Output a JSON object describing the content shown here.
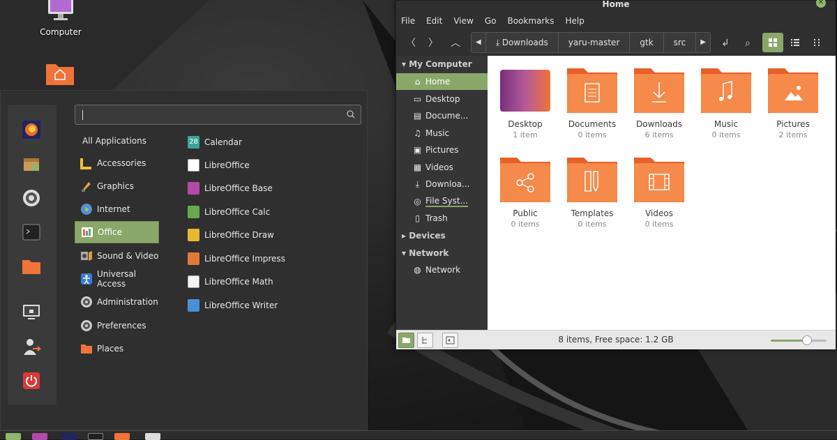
{
  "desktop": {
    "icons": [
      {
        "label": "Computer",
        "icon": "monitor-icon"
      },
      {
        "label": "",
        "icon": "home-folder-icon"
      }
    ]
  },
  "menu": {
    "search": {
      "value": "",
      "placeholder": ""
    },
    "favorites": [
      "firefox-icon",
      "package-icon",
      "settings-icon",
      "terminal-icon",
      "folder-icon",
      "lock-screen-icon",
      "logout-icon",
      "power-icon"
    ],
    "categories": [
      {
        "label": "All Applications"
      },
      {
        "label": "Accessories"
      },
      {
        "label": "Graphics"
      },
      {
        "label": "Internet"
      },
      {
        "label": "Office"
      },
      {
        "label": "Sound & Video"
      },
      {
        "label": "Universal Access"
      },
      {
        "label": "Administration"
      },
      {
        "label": "Preferences"
      },
      {
        "label": "Places"
      }
    ],
    "selected_category": "Office",
    "apps": [
      {
        "label": "Calendar",
        "badge": "28"
      },
      {
        "label": "LibreOffice"
      },
      {
        "label": "LibreOffice Base"
      },
      {
        "label": "LibreOffice Calc"
      },
      {
        "label": "LibreOffice Draw"
      },
      {
        "label": "LibreOffice Impress"
      },
      {
        "label": "LibreOffice Math"
      },
      {
        "label": "LibreOffice Writer"
      }
    ]
  },
  "filemanager": {
    "title": "Home",
    "menubar": [
      "File",
      "Edit",
      "View",
      "Go",
      "Bookmarks",
      "Help"
    ],
    "breadcrumbs": [
      "Downloads",
      "yaru-master",
      "gtk",
      "src"
    ],
    "sidebar": {
      "my_computer": "My Computer",
      "items": [
        "Home",
        "Desktop",
        "Docume...",
        "Music",
        "Pictures",
        "Videos",
        "Downloa...",
        "File Syst...",
        "Trash"
      ],
      "devices": "Devices",
      "network": "Network",
      "network_items": [
        "Network"
      ]
    },
    "files": [
      {
        "name": "Desktop",
        "count": "1 item"
      },
      {
        "name": "Documents",
        "count": "0 items"
      },
      {
        "name": "Downloads",
        "count": "6 items"
      },
      {
        "name": "Music",
        "count": "0 items"
      },
      {
        "name": "Pictures",
        "count": "2 items"
      },
      {
        "name": "Public",
        "count": "0 items"
      },
      {
        "name": "Templates",
        "count": "0 items"
      },
      {
        "name": "Videos",
        "count": "0 items"
      }
    ],
    "status": "8 items, Free space: 1.2 GB",
    "zoom_fraction": 0.65,
    "colors": {
      "accent": "#8aa86a",
      "folder": "#f0733a"
    }
  }
}
